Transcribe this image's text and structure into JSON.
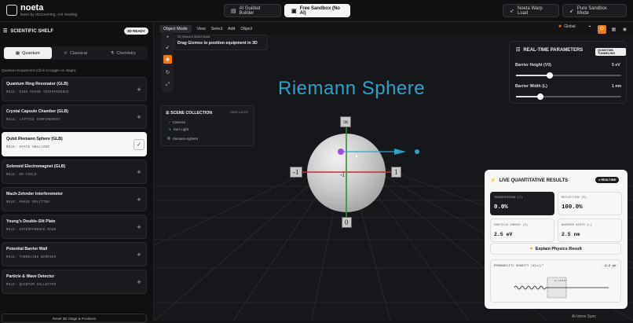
{
  "app": {
    "title": "noeta",
    "subtitle": "learn by discovering, not reading"
  },
  "topbar": {
    "ai_guided": "AI Guided Builder",
    "free_sandbox": "Free Sandbox (No AI)",
    "warp": "Noeta Warp Load",
    "pure": "Pure Sandbox Mode"
  },
  "sidebar": {
    "title": "SCIENTIFIC SHELF",
    "badge": "3D READY",
    "tabs": [
      "Quantum",
      "Classical",
      "Chemistry"
    ],
    "hint": "Quantum Equipment (Click to toggle on stage):",
    "items": [
      {
        "name": "Quantum Ring Resonator (GLB)",
        "role": "ROLE: RING PHASE INTERFERENCE"
      },
      {
        "name": "Crystal Capsule Chamber (GLB)",
        "role": "ROLE: LATTICE CONFINEMENT"
      },
      {
        "name": "Qubit Riemann Sphere (GLB)",
        "role": "ROLE: STATE ANALYZER"
      },
      {
        "name": "Solenoid Electromagnet (GLB)",
        "role": "ROLE: EM FIELD"
      },
      {
        "name": "Mach-Zehnder Interferometer",
        "role": "ROLE: PHASE SPLITTER"
      },
      {
        "name": "Young's Double-Slit Plate",
        "role": "ROLE: INTERFERENCE MASK"
      },
      {
        "name": "Potential Barrier Wall",
        "role": "ROLE: TUNNELING BARRIER"
      },
      {
        "name": "Particle & Wave Detector",
        "role": "ROLE: QUANTUM COLLECTOR"
      }
    ],
    "reset": "Reset 3D Stage & Positions"
  },
  "viewport": {
    "mode": "Object Mode",
    "menu": [
      "View",
      "Select",
      "Add",
      "Object"
    ],
    "global": "Global",
    "hint_small": "3D Shared & Sketch Mode",
    "hint_main": "Drag Gizmos to position equipment in 3D",
    "scene_title": "Riemann Sphere",
    "scene_collection": {
      "title": "SCENE COLLECTION",
      "view_layer": "VIEW LAYER",
      "items": [
        "Camera",
        "Sun Light",
        "riemann-sphere"
      ]
    },
    "sphere_labels": {
      "top": "∞",
      "bottom": "0",
      "left": "-1",
      "right": "1",
      "front": "-i"
    }
  },
  "realtime": {
    "title": "REAL-TIME PARAMETERS",
    "tag": "QUANTUM-TUNNELING",
    "barrier_height_label": "Barrier Height (V0)",
    "barrier_height_value": "5 eV",
    "barrier_height_frac": 0.32,
    "barrier_width_label": "Barrier Width (L)",
    "barrier_width_value": "1 nm",
    "barrier_width_frac": 0.23
  },
  "results": {
    "title": "LIVE QUANTITATIVE RESULTS",
    "badge": "REALTIME",
    "transmission_label": "TRANSMISSION (T)",
    "transmission_value": "0.0%",
    "reflection_label": "REFLECTION (R)",
    "reflection_value": "100.0%",
    "energy_label": "PARTICLE ENERGY (E)",
    "energy_value": "2.5 eV",
    "width_label": "BARRIER WIDTH (L)",
    "width_value": "2.5 nm",
    "explain": "Explain Physics Result",
    "density_label": "PROBABILITY DENSITY |Ψ(x)|²",
    "density_peak": "4.2 pk",
    "barrier_tag": "V₀ = 4.8 eV"
  },
  "footer_hint": "AI Inbox Sync",
  "colors": {
    "accent": "#f07a1a",
    "title": "#2aa3c7"
  }
}
